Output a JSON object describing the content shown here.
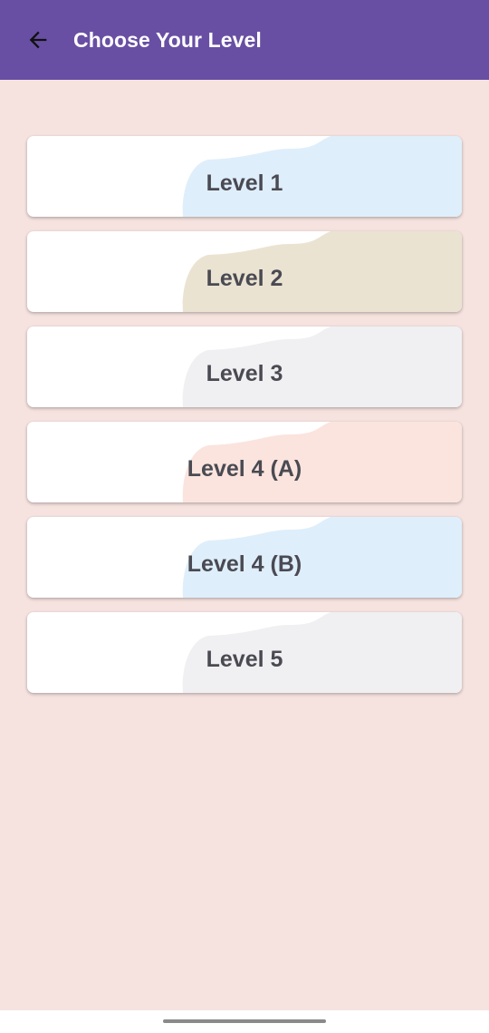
{
  "app_bar": {
    "title": "Choose Your Level",
    "back_icon": "arrow-left-icon",
    "background": "#684fa3"
  },
  "levels": [
    {
      "label": "Level 1",
      "accent": "#dfeefb"
    },
    {
      "label": "Level 2",
      "accent": "#ebe3d2"
    },
    {
      "label": "Level 3",
      "accent": "#f0f0f2"
    },
    {
      "label": "Level 4 (A)",
      "accent": "#fbe4de"
    },
    {
      "label": "Level 4 (B)",
      "accent": "#dfeefb"
    },
    {
      "label": "Level 5",
      "accent": "#f0f0f2"
    }
  ],
  "colors": {
    "background": "#f6e3e0",
    "card": "#ffffff",
    "card_text": "#4a4a52"
  }
}
